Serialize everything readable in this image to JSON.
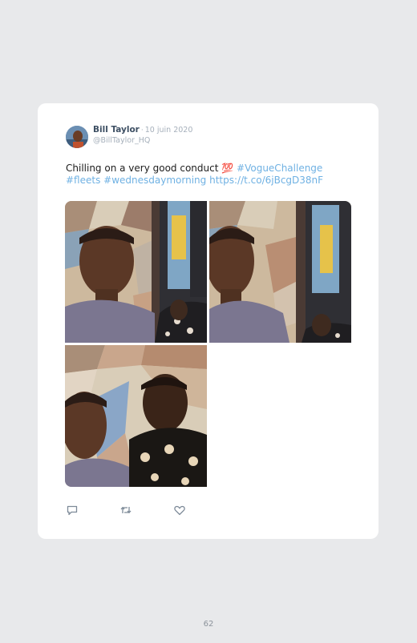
{
  "tweet": {
    "author": {
      "name": "Bill Taylor",
      "handle": "@BillTaylor_HQ",
      "avatar": "profile-photo"
    },
    "separator": "·",
    "date": "10 juin 2020",
    "text": {
      "plain": "Chilling on a very good conduct ",
      "emoji": "💯",
      "space": " ",
      "hashtag1": "#VogueChallenge",
      "hashtag2": "#fleets",
      "hashtag3": "#wednesdaymorning",
      "url": "https://t.co/6jBcgD38nF"
    },
    "media": [
      {
        "subject": "selfie-two-men-mosaic-wall-1"
      },
      {
        "subject": "selfie-two-men-mosaic-wall-2"
      },
      {
        "subject": "selfie-two-men-mosaic-wall-3"
      }
    ],
    "actions": [
      {
        "icon": "reply-icon"
      },
      {
        "icon": "retweet-icon"
      },
      {
        "icon": "like-icon"
      }
    ]
  },
  "page": {
    "number": "62"
  },
  "colors": {
    "background": "#e8e9eb",
    "card": "#ffffff",
    "name": "#3d4f63",
    "meta": "#a6b0bb",
    "link": "#6fb1e3",
    "icon": "#7d8a98"
  }
}
